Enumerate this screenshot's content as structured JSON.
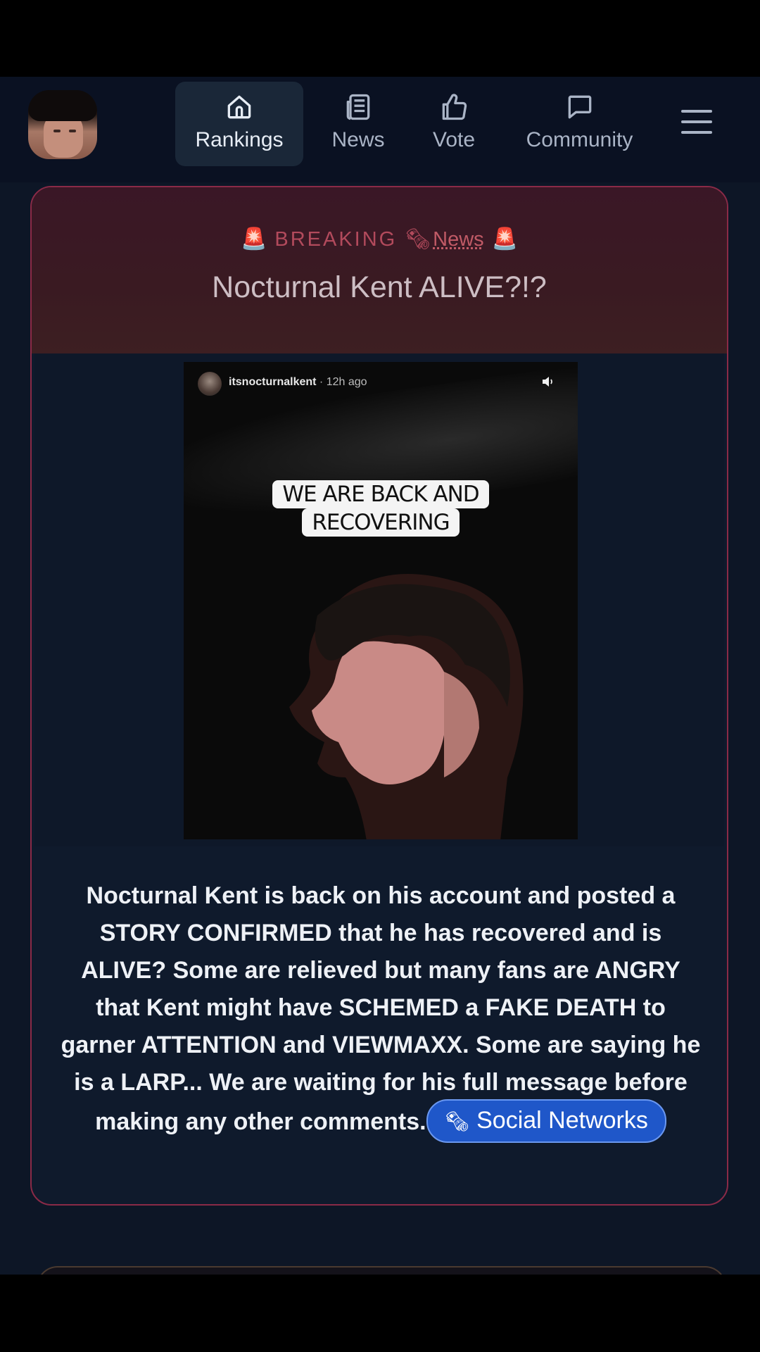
{
  "nav": {
    "items": [
      {
        "label": "Rankings",
        "icon": "home-icon",
        "active": true
      },
      {
        "label": "News",
        "icon": "newspaper-icon",
        "active": false
      },
      {
        "label": "Vote",
        "icon": "thumbs-up-icon",
        "active": false
      },
      {
        "label": "Community",
        "icon": "chat-bubble-icon",
        "active": false
      }
    ],
    "menu_icon": "hamburger-menu-icon"
  },
  "article": {
    "siren_icon": "🚨",
    "breaking_label": "BREAKING",
    "news_icon": "🗞",
    "news_link": "News",
    "headline": "Nocturnal Kent ALIVE?!?",
    "story": {
      "username": "itsnocturnalkent",
      "time_ago": " · 12h ago",
      "caption": "WE ARE BACK AND RECOVERING"
    },
    "body": "Nocturnal Kent is back on his account and posted a STORY CONFIRMED that he has recovered and is ALIVE? Some are relieved but many fans are ANGRY that Kent might have SCHEMED a FAKE DEATH to garner ATTENTION and VIEWMAXX. Some are saying he is a LARP... We are waiting for his full message before making any other comments.",
    "tag": {
      "icon": "🗞",
      "label": "Social Networks"
    }
  },
  "colors": {
    "accent_border": "#8a2a47",
    "tag_blue": "#1f57c9",
    "header_bg": "#0a1122"
  }
}
